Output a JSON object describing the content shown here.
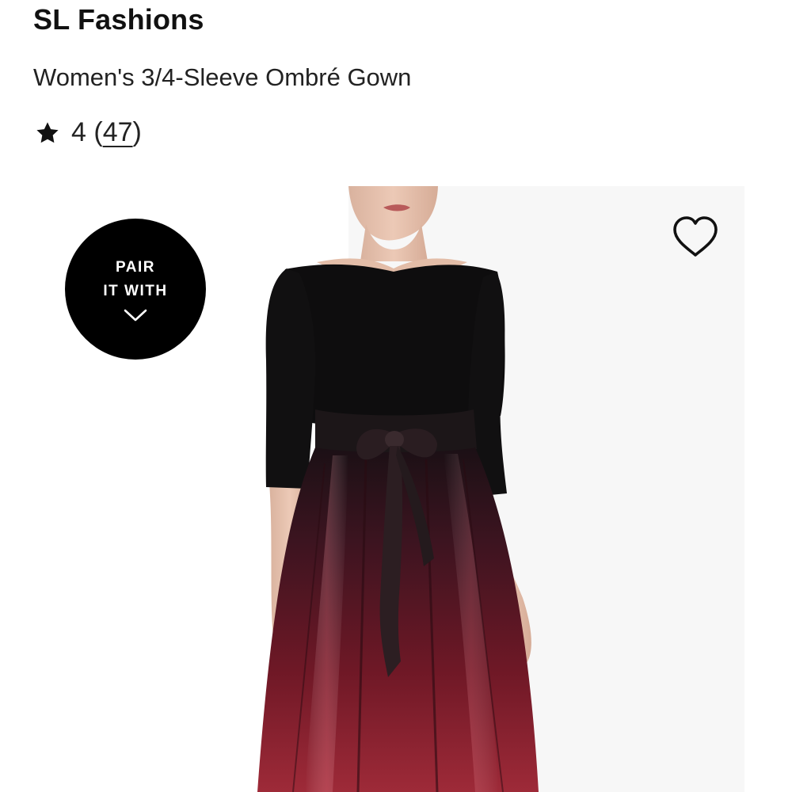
{
  "product": {
    "brand": "SL Fashions",
    "name": "Women's 3/4-Sleeve Ombré Gown",
    "rating": {
      "value": "4",
      "open_paren": " (",
      "count": "47",
      "close_paren": ")",
      "stars_shown": 1
    }
  },
  "pair_badge": {
    "line1": "PAIR",
    "line2": "IT WITH"
  },
  "icons": {
    "rating": "star-icon",
    "wishlist": "heart-icon",
    "expand": "chevron-down-icon"
  },
  "colors": {
    "badge_bg": "#000000",
    "badge_text": "#ffffff",
    "text": "#1a1a1a",
    "gown_top": "#0d0c0d",
    "gown_skirt": "#8a1d2a"
  }
}
